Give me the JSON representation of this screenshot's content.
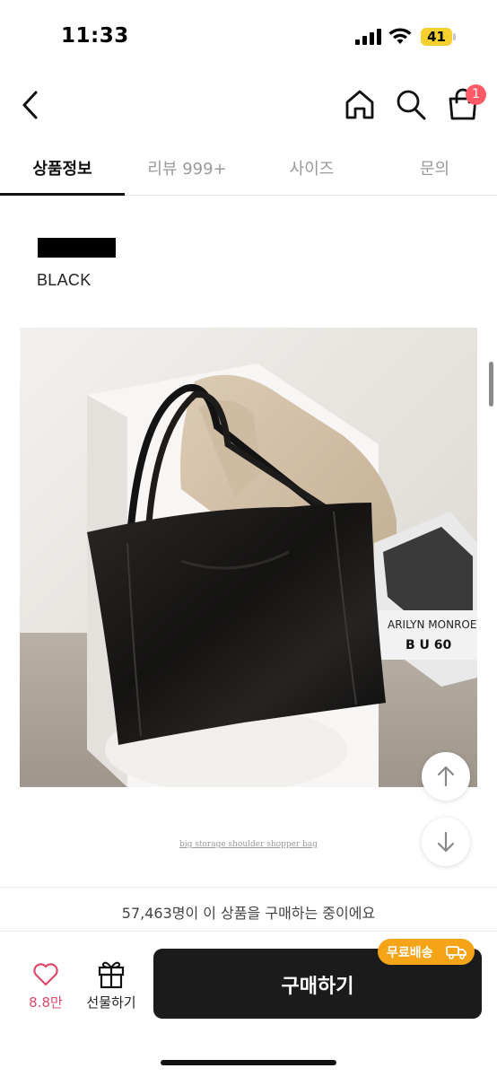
{
  "status_bar": {
    "time": "11:33",
    "battery": "41"
  },
  "nav": {
    "cart_count": "1"
  },
  "tabs": [
    {
      "label": "상품정보",
      "active": true
    },
    {
      "label": "리뷰 999+",
      "active": false
    },
    {
      "label": "사이즈",
      "active": false
    },
    {
      "label": "문의",
      "active": false
    }
  ],
  "product": {
    "color_name": "BLACK",
    "swatch_color": "#000000",
    "image_caption": "big storage shoulder shopper bag"
  },
  "purchase_status": "57,463명이 이 상품을 구매하는 중이에요",
  "actions": {
    "like_count": "8.8만",
    "gift_label": "선물하기",
    "buy_label": "구매하기",
    "free_shipping_label": "무료배송"
  },
  "colors": {
    "badge": "#ff5a66",
    "like": "#e04a6b",
    "free_shipping": "#f5a418",
    "buy_button": "#1b1b1b"
  },
  "icons": [
    "back-icon",
    "home-icon",
    "search-icon",
    "cart-icon",
    "scroll-up-icon",
    "scroll-down-icon",
    "heart-icon",
    "gift-icon",
    "truck-icon"
  ]
}
